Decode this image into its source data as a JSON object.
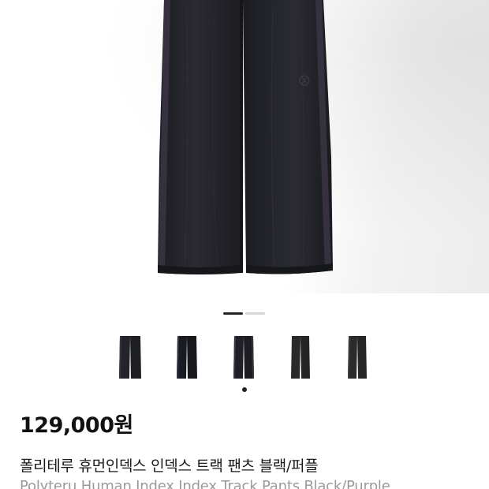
{
  "product": {
    "price": "129,000원",
    "title_ko": "폴리테루 휴먼인덱스 인덱스 트랙 팬츠 블랙/퍼플",
    "title_en": "Polyteru Human Index Index Track Pants Black/Purple"
  },
  "gallery": {
    "image_icon": "track-pants-image",
    "page_indicator_total": 2,
    "page_indicator_active": 1,
    "thumbnail_count": 5,
    "thumbnail_selected": 3
  },
  "colors": {
    "pants_main": "#1f2026",
    "pants_stripe": "#3a3342",
    "indicator_active": "#222222",
    "indicator_inactive": "#d6d6d6"
  }
}
